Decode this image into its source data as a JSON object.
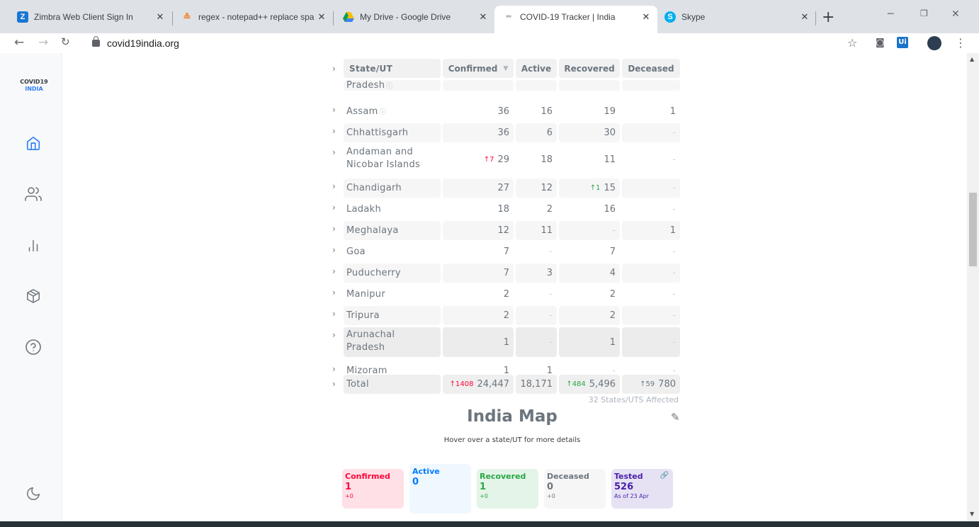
{
  "browser": {
    "tabs": [
      {
        "label": "Zimbra Web Client Sign In",
        "icon": "zimbra-icon",
        "color": "#1976d2"
      },
      {
        "label": "regex - notepad++ replace spa",
        "icon": "stackoverflow-icon",
        "color": "#f48024"
      },
      {
        "label": "My Drive - Google Drive",
        "icon": "google-drive-icon",
        "color": "#fbbc04"
      },
      {
        "label": "COVID-19 Tracker | India",
        "icon": "covid19india-icon",
        "color": "#6c757d"
      },
      {
        "label": "Skype",
        "icon": "skype-icon",
        "color": "#00aff0"
      }
    ],
    "url": "covid19india.org"
  },
  "sidebar": {
    "brand_line1": "COVID19",
    "brand_line2": "INDIA",
    "items": [
      "home-icon",
      "users-icon",
      "bar-chart-icon",
      "package-icon",
      "help-circle-icon",
      "moon-icon"
    ]
  },
  "table": {
    "headers": {
      "state": "State/UT",
      "confirmed": "Confirmed",
      "active": "Active",
      "recovered": "Recovered",
      "deceased": "Deceased"
    },
    "partial_row": "Pradesh",
    "rows": [
      {
        "name": "Assam",
        "info": true,
        "confirmed": "36",
        "cdelta": "",
        "active": "16",
        "recovered": "19",
        "rdelta": "",
        "deceased": "1"
      },
      {
        "name": "Chhattisgarh",
        "confirmed": "36",
        "cdelta": "",
        "active": "6",
        "recovered": "30",
        "rdelta": "",
        "deceased": "-"
      },
      {
        "name": "Andaman and Nicobar Islands",
        "confirmed": "29",
        "cdelta": "↑7",
        "active": "18",
        "recovered": "11",
        "rdelta": "",
        "deceased": "-"
      },
      {
        "name": "Chandigarh",
        "confirmed": "27",
        "cdelta": "",
        "active": "12",
        "recovered": "15",
        "rdelta": "↑1",
        "deceased": "-"
      },
      {
        "name": "Ladakh",
        "confirmed": "18",
        "cdelta": "",
        "active": "2",
        "recovered": "16",
        "rdelta": "",
        "deceased": "-"
      },
      {
        "name": "Meghalaya",
        "confirmed": "12",
        "cdelta": "",
        "active": "11",
        "recovered": "-",
        "rdelta": "",
        "deceased": "1"
      },
      {
        "name": "Goa",
        "confirmed": "7",
        "cdelta": "",
        "active": "-",
        "recovered": "7",
        "rdelta": "",
        "deceased": "-"
      },
      {
        "name": "Puducherry",
        "confirmed": "7",
        "cdelta": "",
        "active": "3",
        "recovered": "4",
        "rdelta": "",
        "deceased": "-"
      },
      {
        "name": "Manipur",
        "confirmed": "2",
        "cdelta": "",
        "active": "-",
        "recovered": "2",
        "rdelta": "",
        "deceased": "-"
      },
      {
        "name": "Tripura",
        "confirmed": "2",
        "cdelta": "",
        "active": "-",
        "recovered": "2",
        "rdelta": "",
        "deceased": "-"
      },
      {
        "name": "Arunachal Pradesh",
        "confirmed": "1",
        "cdelta": "",
        "active": "-",
        "recovered": "1",
        "rdelta": "",
        "deceased": "-"
      },
      {
        "name": "Mizoram",
        "confirmed": "1",
        "cdelta": "",
        "active": "1",
        "recovered": "-",
        "rdelta": "",
        "deceased": "-"
      }
    ],
    "total": {
      "name": "Total",
      "confirmed": "24,447",
      "cdelta": "↑1408",
      "active": "18,171",
      "recovered": "5,496",
      "rdelta": "↑484",
      "deceased": "780",
      "ddelta": "↑59"
    },
    "affected": "32 States/UTS Affected"
  },
  "map": {
    "title": "India Map",
    "hint": "Hover over a state/UT for more details",
    "cards": [
      {
        "label": "Confirmed",
        "value": "1",
        "delta": "+0",
        "color": "#ff073a",
        "bg": "#ffe0e6"
      },
      {
        "label": "Active",
        "value": "0",
        "delta": "",
        "color": "#007bff",
        "bg": "#eff7ff"
      },
      {
        "label": "Recovered",
        "value": "1",
        "delta": "+0",
        "color": "#28a745",
        "bg": "#e4f4e8"
      },
      {
        "label": "Deceased",
        "value": "0",
        "delta": "+0",
        "color": "#6c757d",
        "bg": "#f6f6f7"
      },
      {
        "label": "Tested",
        "value": "526",
        "delta": "As of 23 Apr",
        "color": "#4b1eaa",
        "bg": "#e6e2f4"
      }
    ]
  }
}
